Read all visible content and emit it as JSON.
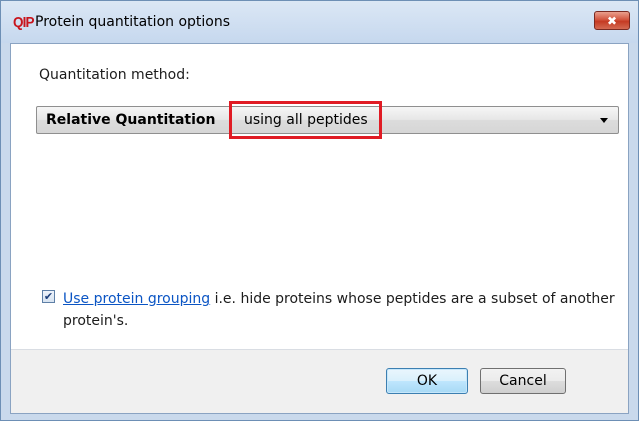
{
  "window": {
    "app_logo": "QIP",
    "title": "Protein quantitation options",
    "close_glyph": "✖"
  },
  "method": {
    "label": "Quantitation method:",
    "selected_bold": "Relative Quantitation",
    "selected_rest": "using all peptides"
  },
  "grouping": {
    "checked": true,
    "check_glyph": "✔",
    "link_text": "Use protein grouping",
    "description": " i.e. hide proteins whose peptides are a subset of another protein's."
  },
  "buttons": {
    "ok": "OK",
    "cancel": "Cancel"
  },
  "colors": {
    "highlight": "#e01b24",
    "link": "#0b55c4",
    "logo": "#c8141c"
  }
}
